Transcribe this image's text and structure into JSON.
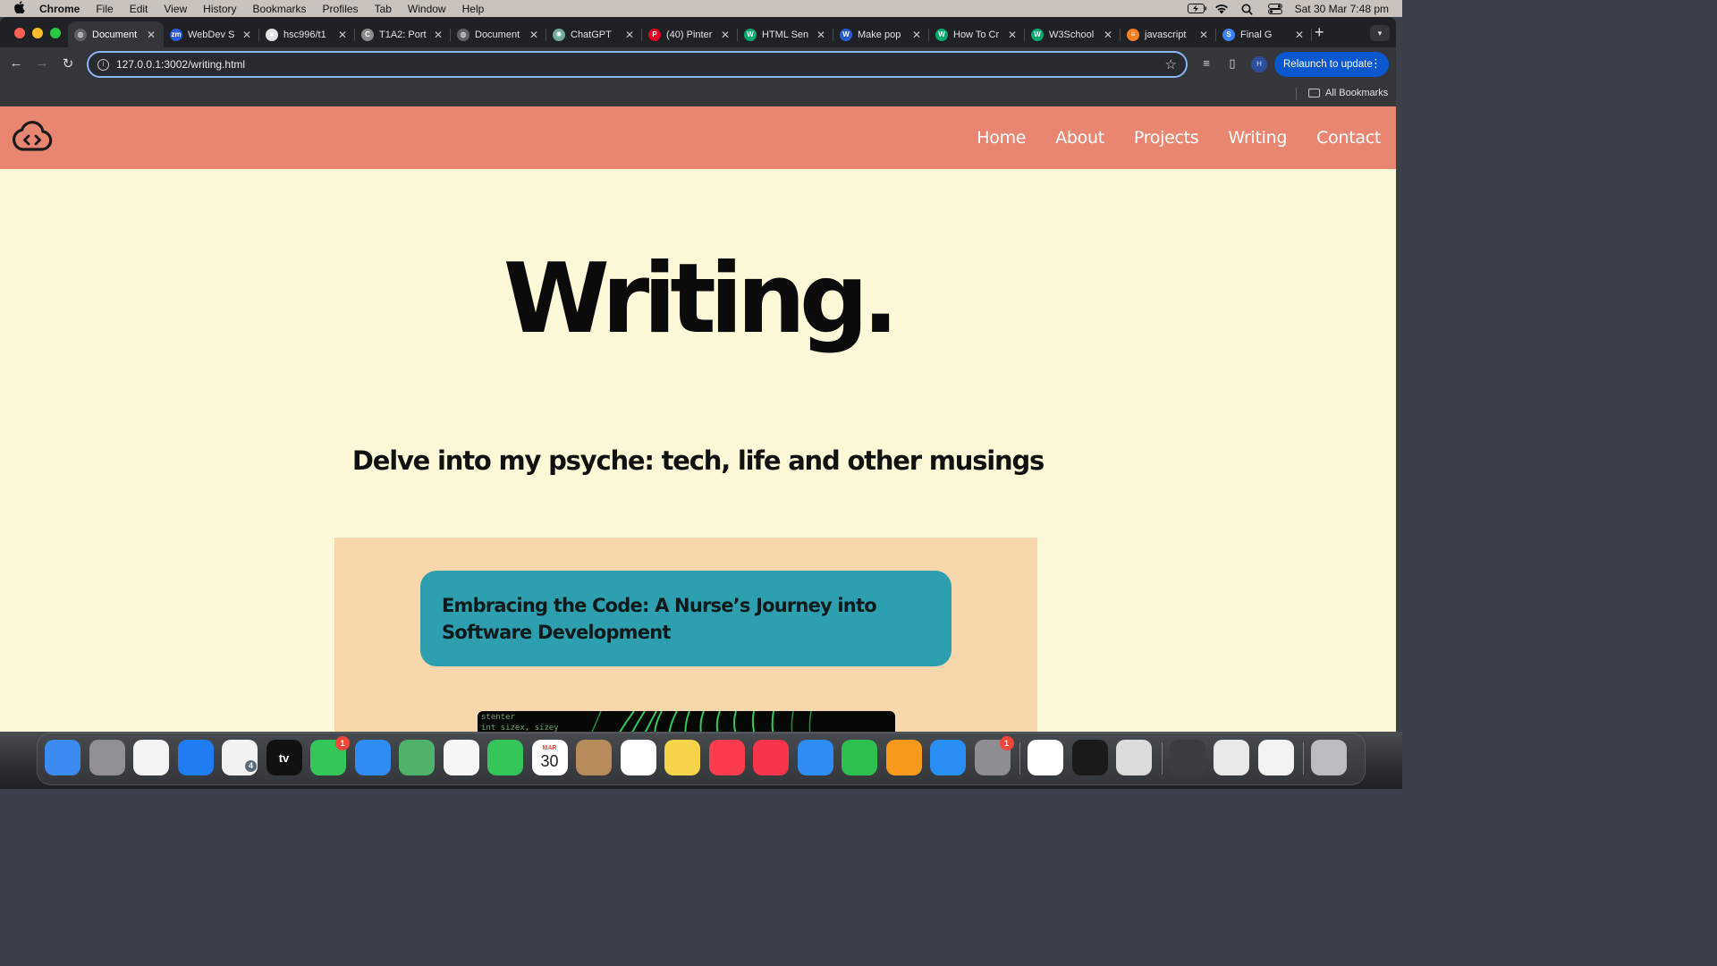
{
  "menubar": {
    "app_name": "Chrome",
    "items": [
      "File",
      "Edit",
      "View",
      "History",
      "Bookmarks",
      "Profiles",
      "Tab",
      "Window",
      "Help"
    ],
    "datetime": "Sat 30 Mar  7:48 pm"
  },
  "browser": {
    "tabs": [
      {
        "title": "Document",
        "icon": "globe-icon",
        "color": "#5f6368",
        "active": true
      },
      {
        "title": "WebDev S",
        "icon": "zoom-icon",
        "color": "#2d5bdc"
      },
      {
        "title": "hsc996/t1",
        "icon": "github-icon",
        "color": "#e3e3e3"
      },
      {
        "title": "T1A2: Port",
        "icon": "canvas-icon",
        "color": "#8a8a8a"
      },
      {
        "title": "Document",
        "icon": "globe-icon",
        "color": "#5f6368"
      },
      {
        "title": "ChatGPT",
        "icon": "chatgpt-icon",
        "color": "#74aa9c"
      },
      {
        "title": "(40) Pinter",
        "icon": "pinterest-icon",
        "color": "#e60023"
      },
      {
        "title": "HTML Sen",
        "icon": "w3schools-icon",
        "color": "#04aa6d"
      },
      {
        "title": "Make pop",
        "icon": "doc-icon",
        "color": "#2a5bd7"
      },
      {
        "title": "How To Cr",
        "icon": "w3schools-icon",
        "color": "#04aa6d"
      },
      {
        "title": "W3School",
        "icon": "w3schools-icon",
        "color": "#04aa6d"
      },
      {
        "title": "javascript",
        "icon": "stackoverflow-icon",
        "color": "#f48024"
      },
      {
        "title": "Final G",
        "icon": "s-icon",
        "color": "#3b82f6"
      }
    ],
    "url": "127.0.0.1:3002/writing.html",
    "relaunch_label": "Relaunch to update",
    "profile_initial": "H",
    "all_bookmarks_label": "All Bookmarks"
  },
  "site": {
    "nav": [
      "Home",
      "About",
      "Projects",
      "Writing",
      "Contact"
    ],
    "heading": "Writing.",
    "subtitle": "Delve into my psyche: tech, life and other musings",
    "article_title": "Embracing the Code: A Nurse’s Journey into Software Development",
    "colors": {
      "header": "#e98672",
      "background": "#fdf9d8",
      "panel": "#f9d7ac",
      "card": "#2e9fae"
    }
  },
  "dock": {
    "apps": [
      {
        "name": "finder-icon",
        "color": "#3d8bf0"
      },
      {
        "name": "launchpad-icon",
        "color": "#8f8f95"
      },
      {
        "name": "freeform-icon",
        "color": "#f4f4f4"
      },
      {
        "name": "safari-icon",
        "color": "#1f7cf3"
      },
      {
        "name": "chrome-icon",
        "color": "#f2f2f2",
        "badge_sub": "4"
      },
      {
        "name": "apple-tv-icon",
        "color": "#111111",
        "label": "tv"
      },
      {
        "name": "messages-icon",
        "color": "#35c659",
        "badge": "1"
      },
      {
        "name": "mail-icon",
        "color": "#2f8cf2"
      },
      {
        "name": "maps-icon",
        "color": "#4fb36b"
      },
      {
        "name": "photos-icon",
        "color": "#f7f7f7"
      },
      {
        "name": "facetime-icon",
        "color": "#35c659"
      },
      {
        "name": "calendar-icon",
        "color": "#ffffff",
        "month": "MAR",
        "day": "30"
      },
      {
        "name": "contacts-icon",
        "color": "#b88b5a"
      },
      {
        "name": "reminders-icon",
        "color": "#ffffff"
      },
      {
        "name": "notes-icon",
        "color": "#f6d54a"
      },
      {
        "name": "music-icon",
        "color": "#fa3c4c"
      },
      {
        "name": "news-icon",
        "color": "#f4354a"
      },
      {
        "name": "keynote-icon",
        "color": "#2f8cf2"
      },
      {
        "name": "numbers-icon",
        "color": "#2fbf4e"
      },
      {
        "name": "pages-icon",
        "color": "#f79a1b"
      },
      {
        "name": "app-store-icon",
        "color": "#2a8ff5"
      },
      {
        "name": "system-settings-icon",
        "color": "#8d8d92",
        "badge": "1"
      },
      {
        "name": "vscode-icon",
        "color": "#ffffff"
      },
      {
        "name": "terminal-icon",
        "color": "#1a1a1a"
      },
      {
        "name": "preview-icon",
        "color": "#dcdcdc"
      },
      {
        "name": "recent-window-1-icon",
        "color": "#3b3d42"
      },
      {
        "name": "recent-window-2-icon",
        "color": "#e8e8e8"
      },
      {
        "name": "recent-window-3-icon",
        "color": "#f3f3f3"
      },
      {
        "name": "trash-icon",
        "color": "#b9bcc0"
      }
    ]
  }
}
